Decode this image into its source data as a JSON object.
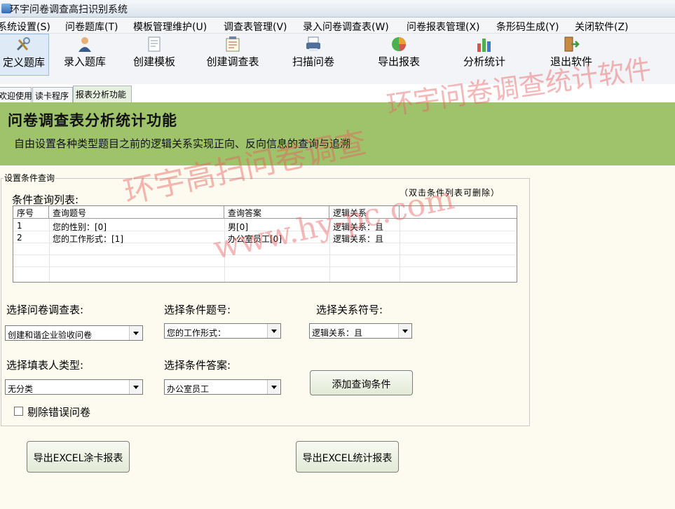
{
  "window": {
    "title": "环宇问卷调查高扫识别系统"
  },
  "menu": [
    "系统设置(S)",
    "问卷题库(T)",
    "模板管理维护(U)",
    "调查表管理(V)",
    "录入问卷调查表(W)",
    "问卷报表管理(X)",
    "条形码生成(Y)",
    "关闭软件(Z)"
  ],
  "toolbar": [
    {
      "label": "定义题库",
      "icon": "tools-icon"
    },
    {
      "label": "录入题库",
      "icon": "person-icon"
    },
    {
      "label": "创建模板",
      "icon": "document-icon"
    },
    {
      "label": "创建调查表",
      "icon": "notepad-icon"
    },
    {
      "label": "扫描问卷",
      "icon": "scanner-icon"
    },
    {
      "label": "导出报表",
      "icon": "pie-chart-icon"
    },
    {
      "label": "分析统计",
      "icon": "bar-chart-icon"
    },
    {
      "label": "退出软件",
      "icon": "exit-door-icon"
    }
  ],
  "tabs": [
    "欢迎使用",
    "读卡程序",
    "报表分析功能"
  ],
  "banner": {
    "title": "问卷调查表分析统计功能",
    "subtitle": "自由设置各种类型题目之前的逻辑关系实现正向、反向信息的查询与追溯"
  },
  "query": {
    "group_title": "设置条件查询",
    "list_label": "条件查询列表:",
    "hint": "（双击条件列表可删除）",
    "columns": [
      "序号",
      "查询题号",
      "查询答案",
      "逻辑关系"
    ],
    "rows": [
      [
        "1",
        "您的性别：[0]",
        "男[0]",
        "逻辑关系：且"
      ],
      [
        "2",
        "您的工作形式：[1]",
        "办公室员工[0]",
        "逻辑关系：且"
      ]
    ]
  },
  "form": {
    "survey_label": "选择问卷调查表:",
    "survey_value": "创建和谐企业验收问卷",
    "question_label": "选择条件题号:",
    "question_value": "您的工作形式：",
    "relation_label": "选择关系符号:",
    "relation_value": "逻辑关系：且",
    "filler_label": "选择填表人类型:",
    "filler_value": "无分类",
    "answer_label": "选择条件答案:",
    "answer_value": "办公室员工",
    "add_button": "添加查询条件",
    "exclude_label": "剔除错误问卷"
  },
  "actions": {
    "export_card": "导出EXCEL涂卡报表",
    "export_stats": "导出EXCEL统计报表"
  },
  "watermark": {
    "line1": "环宇问卷调查统计软件",
    "line2": "环宇高扫问卷调查",
    "line3": "www.hy-pc.com"
  },
  "colors": {
    "banner": "#9ec36a",
    "content_bg": "#fdfbef",
    "watermark": "#e86060"
  }
}
